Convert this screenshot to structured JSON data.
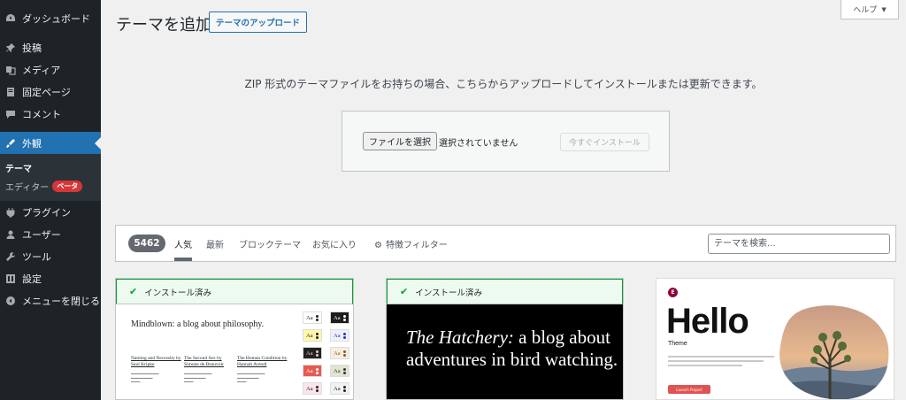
{
  "sidebar": {
    "items": [
      {
        "label": "ダッシュボード",
        "icon": "dashboard-icon"
      },
      {
        "label": "投稿",
        "icon": "pin-icon"
      },
      {
        "label": "メディア",
        "icon": "media-icon"
      },
      {
        "label": "固定ページ",
        "icon": "pages-icon"
      },
      {
        "label": "コメント",
        "icon": "comment-icon"
      },
      {
        "label": "外観",
        "icon": "appearance-icon"
      },
      {
        "label": "プラグイン",
        "icon": "plugin-icon"
      },
      {
        "label": "ユーザー",
        "icon": "user-icon"
      },
      {
        "label": "ツール",
        "icon": "wrench-icon"
      },
      {
        "label": "設定",
        "icon": "settings-icon"
      },
      {
        "label": "メニューを閉じる",
        "icon": "collapse-icon"
      }
    ],
    "submenu": {
      "themes": "テーマ",
      "editor": "エディター",
      "beta": "ベータ"
    }
  },
  "header": {
    "title": "テーマを追加",
    "upload_button": "テーマのアップロード",
    "help": "ヘルプ"
  },
  "upload": {
    "description": "ZIP 形式のテーマファイルをお持ちの場合、こちらからアップロードしてインストールまたは更新できます。",
    "choose_file": "ファイルを選択",
    "no_file": "選択されていません",
    "install_now": "今すぐインストール"
  },
  "filter": {
    "count": "5462",
    "tabs": [
      "人気",
      "最新",
      "ブロックテーマ",
      "お気に入り"
    ],
    "feature_filter": "特徴フィルター",
    "search_placeholder": "テーマを検索..."
  },
  "cards": [
    {
      "installed": "インストール済み",
      "headline": "Mindblown: a blog about philosophy.",
      "books": [
        {
          "title": "Naming and Necessity by Saul Kripke"
        },
        {
          "title": "The Second Sex by Simone de Beauvoir"
        },
        {
          "title": "The Human Condition by Hannah Arendt"
        }
      ],
      "swatch_label": "Aa"
    },
    {
      "installed": "インストール済み",
      "italic": "The Hatchery:",
      "rest": " a blog about adventures in bird watching."
    },
    {
      "logo": "E",
      "hello": "Hello",
      "theme": "Theme",
      "button": "Launch Project"
    }
  ],
  "colors": {
    "sidebar_bg": "#1d2327",
    "accent": "#2271b1",
    "installed_green": "#00a32a",
    "beta_red": "#d63638"
  }
}
